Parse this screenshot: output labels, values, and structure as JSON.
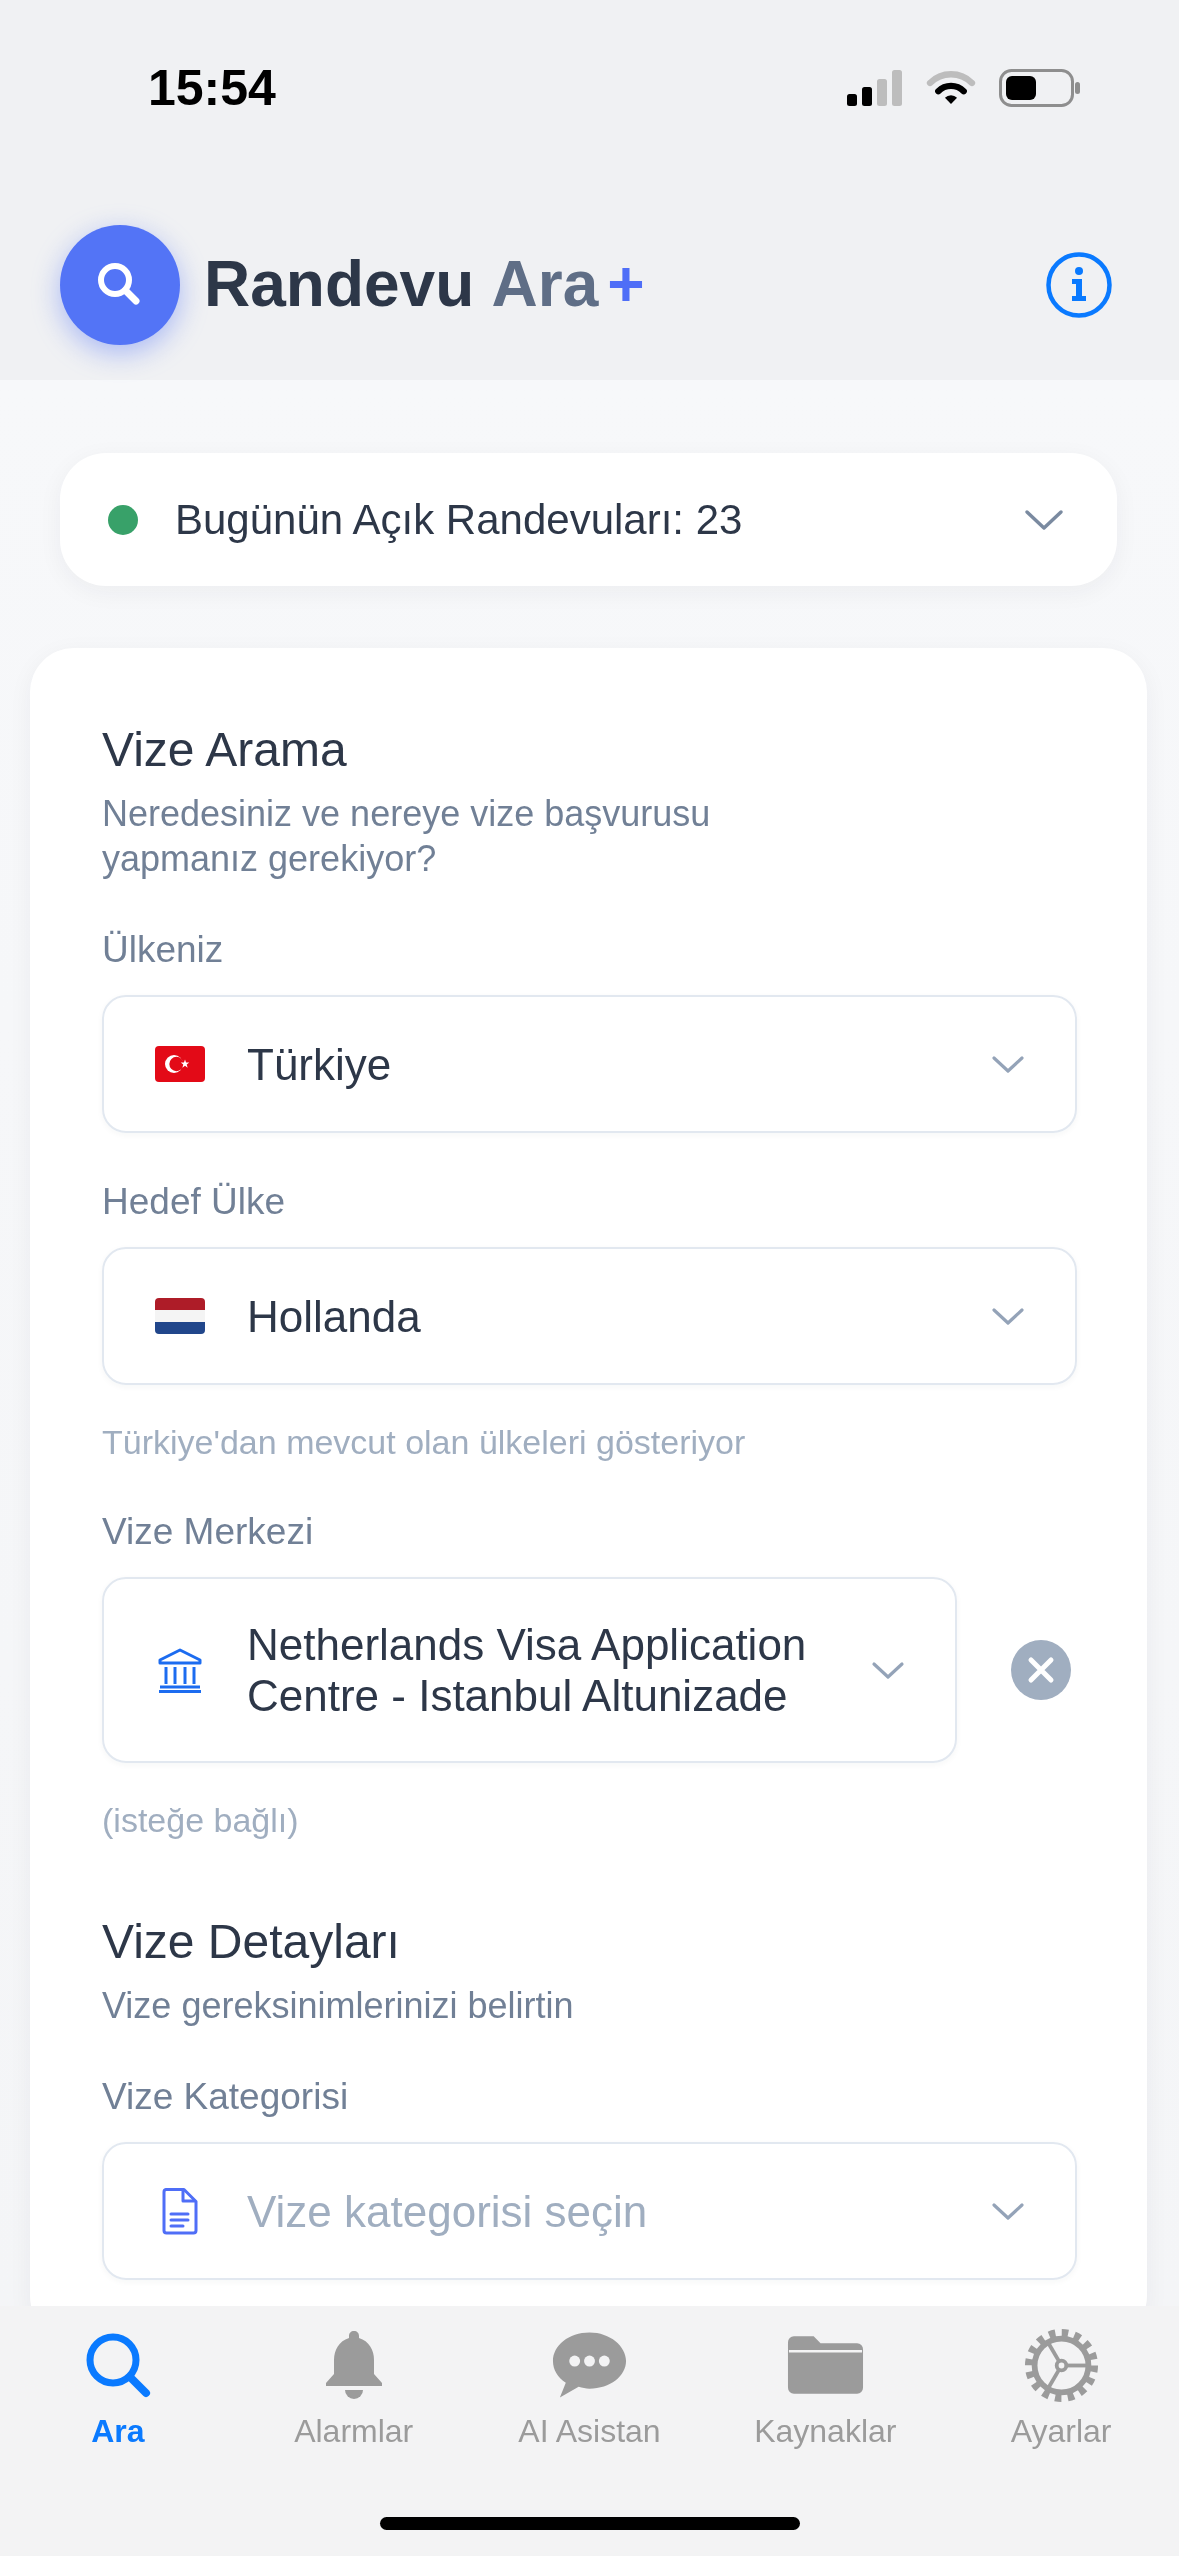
{
  "status_bar": {
    "time": "15:54"
  },
  "header": {
    "title_parts": [
      {
        "text": "Randevu",
        "kind": "main"
      },
      {
        "text": "Ara",
        "kind": "muted"
      },
      {
        "text": "+",
        "kind": "accent"
      }
    ]
  },
  "summary": {
    "text": "Bugünün Açık Randevuları: 23",
    "expanded": false
  },
  "sections": [
    {
      "title": "Vize Arama",
      "subtitle": "Neredesiniz ve nereye vize başvurusu yapmanız gerekiyor?",
      "fields": [
        {
          "label": "Ülkeniz",
          "kind": "flag",
          "value": "Türkiye",
          "clearable": false
        },
        {
          "label": "Hedef Ülke",
          "kind": "flag",
          "value": "Hollanda",
          "clearable": false,
          "hint": "Türkiye'dan mevcut olan ülkeleri gösteriyor"
        },
        {
          "label": "Vize Merkezi",
          "kind": "building",
          "value": "Netherlands Visa Application Centre - Istanbul Altunizade",
          "clearable": true,
          "hint": "(isteğe bağlı)"
        }
      ]
    },
    {
      "title": "Vize Detayları",
      "subtitle": "Vize gereksinimlerinizi belirtin",
      "fields": [
        {
          "label": "Vize Kategorisi",
          "kind": "document",
          "placeholder": "Vize kategorisi seçin",
          "clearable": false
        }
      ]
    }
  ],
  "tabs": [
    {
      "label": "Ara",
      "selected": true
    },
    {
      "label": "Alarmlar",
      "selected": false
    },
    {
      "label": "AI Asistan",
      "selected": false
    },
    {
      "label": "Kaynaklar",
      "selected": false
    },
    {
      "label": "Ayarlar",
      "selected": false
    }
  ]
}
